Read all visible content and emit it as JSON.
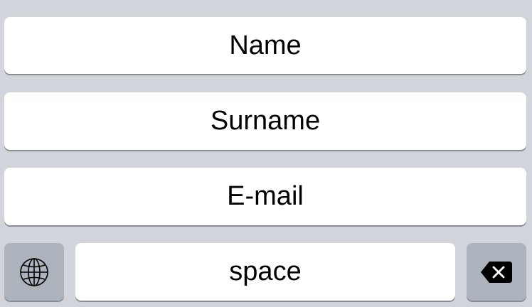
{
  "keyboard": {
    "suggestions": [
      {
        "label": "Name"
      },
      {
        "label": "Surname"
      },
      {
        "label": "E-mail"
      }
    ],
    "bottom_row": {
      "globe_icon": "globe-icon",
      "space_label": "space",
      "delete_icon": "backspace-icon"
    }
  },
  "colors": {
    "background": "#d1d5db",
    "key_light": "#ffffff",
    "key_dark": "#acb3bc",
    "key_shadow": "#8a8d93"
  }
}
